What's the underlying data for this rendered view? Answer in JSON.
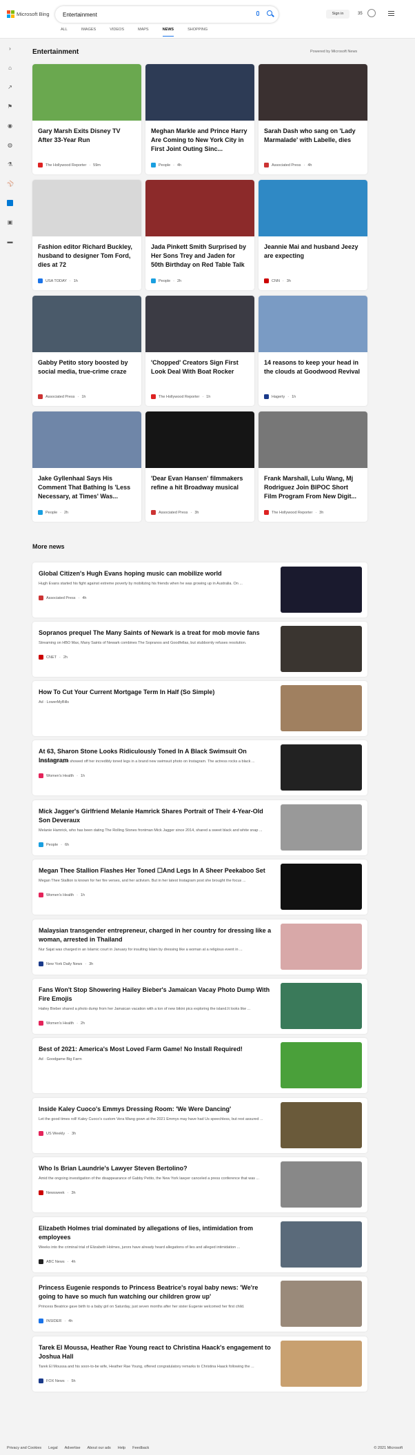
{
  "header": {
    "logo_text": "Microsoft Bing",
    "search_value": "Entertainment",
    "signin": "Sign in",
    "points": "35",
    "tabs": [
      "ALL",
      "IMAGES",
      "VIDEOS",
      "MAPS",
      "NEWS",
      "SHOPPING"
    ],
    "active_tab": "NEWS"
  },
  "section": {
    "title": "Entertainment",
    "powered": "Powered by Microsoft News"
  },
  "cards": [
    {
      "title": "Gary Marsh Exits Disney TV After 33-Year Run",
      "source": "The Hollywood Reporter",
      "time": "59m",
      "color": "#d22",
      "img": "#6aa84f"
    },
    {
      "title": "Meghan Markle and Prince Harry Are Coming to New York City in First Joint Outing Sinc...",
      "source": "People",
      "time": "4h",
      "color": "#1a9fe0",
      "img": "#2d3b55"
    },
    {
      "title": "Sarah Dash who sang on 'Lady Marmalade' with Labelle, dies",
      "source": "Associated Press",
      "time": "4h",
      "color": "#c33",
      "img": "#3a3030"
    },
    {
      "title": "Fashion editor Richard Buckley, husband to designer Tom Ford, dies at 72",
      "source": "USA TODAY",
      "time": "1h",
      "color": "#1a73e8",
      "img": "#d8d8d8"
    },
    {
      "title": "Jada Pinkett Smith Surprised by Her Sons Trey and Jaden for 50th Birthday on Red Table Talk",
      "source": "People",
      "time": "2h",
      "color": "#1a9fe0",
      "img": "#8c2a2a"
    },
    {
      "title": "Jeannie Mai and husband Jeezy are expecting",
      "source": "CNN",
      "time": "3h",
      "color": "#c00",
      "img": "#2f89c5"
    },
    {
      "title": "Gabby Petito story boosted by social media, true-crime craze",
      "source": "Associated Press",
      "time": "1h",
      "color": "#c33",
      "img": "#4a5a6a"
    },
    {
      "title": "'Chopped' Creators Sign First Look Deal With Boat Rocker",
      "source": "The Hollywood Reporter",
      "time": "1h",
      "color": "#d22",
      "img": "#3b3b44"
    },
    {
      "title": "14 reasons to keep your head in the clouds at Goodwood Revival",
      "source": "Hagerty",
      "time": "1h",
      "color": "#1a3a8a",
      "img": "#7a9bc4"
    },
    {
      "title": "Jake Gyllenhaal Says His Comment That Bathing Is 'Less Necessary, at Times' Was...",
      "source": "People",
      "time": "2h",
      "color": "#1a9fe0",
      "img": "#6f86a8"
    },
    {
      "title": "'Dear Evan Hansen' filmmakers refine a hit Broadway musical",
      "source": "Associated Press",
      "time": "3h",
      "color": "#c33",
      "img": "#151515"
    },
    {
      "title": "Frank Marshall, Lulu Wang, Mj Rodriguez Join BIPOC Short Film Program From New Digit...",
      "source": "The Hollywood Reporter",
      "time": "3h",
      "color": "#d22",
      "img": "#777"
    }
  ],
  "more_title": "More news",
  "rows": [
    {
      "title": "Global Citizen's Hugh Evans hoping music can mobilize world",
      "desc": "Hugh Evans started his fight against extreme poverty by mobilizing his friends when he was growing up in Australia. On ...",
      "source": "Associated Press",
      "time": "4h",
      "color": "#c33",
      "img": "#1a1a2e"
    },
    {
      "title": "Sopranos prequel The Many Saints of Newark is a treat for mob movie fans",
      "desc": "Streaming on HBO Max, Many Saints of Newark combines The Sopranos and Goodfellas, but stubbornly refuses resolution.",
      "source": "CNET",
      "time": "2h",
      "color": "#c00",
      "img": "#3a3530"
    },
    {
      "title": "How To Cut Your Current Mortgage Term In Half (So Simple)",
      "desc": "",
      "source": "Ad · LowerMyBills",
      "time": "",
      "color": "",
      "img": "#a08060"
    },
    {
      "title": "At 63, Sharon Stone Looks Ridiculously Toned In A Black Swimsuit On Instagram",
      "desc": "Sharon Stone just showed off her incredibly toned legs in a brand new swimsuit photo on Instagram. The actress rocks a black ...",
      "source": "Women's Health",
      "time": "1h",
      "color": "#e4245a",
      "img": "#222"
    },
    {
      "title": "Mick Jagger's Girlfriend Melanie Hamrick Shares Portrait of Their 4-Year-Old Son Deveraux",
      "desc": "Melanie Hamrick, who has been dating The Rolling Stones frontman Mick Jagger since 2014, shared a sweet black and white snap ...",
      "source": "People",
      "time": "6h",
      "color": "#1a9fe0",
      "img": "#999"
    },
    {
      "title": "Megan Thee Stallion Flashes Her Toned ☐And Legs In A Sheer Peekaboo Set",
      "desc": "Megan Thee Stallion is known for her fire verses, and her activism. But in her latest Instagram post she brought the focus ...",
      "source": "Women's Health",
      "time": "1h",
      "color": "#e4245a",
      "img": "#111"
    },
    {
      "title": "Malaysian transgender entrepreneur, charged in her country for dressing like a woman, arrested in Thailand",
      "desc": "Nur Sajat was charged in an Islamic court in January for insulting Islam by dressing like a woman at a religious event in ...",
      "source": "New York Daily News",
      "time": "3h",
      "color": "#1a3a8a",
      "img": "#d8a8a8"
    },
    {
      "title": "Fans Won't Stop Showering Hailey Bieber's Jamaican Vacay Photo Dump With Fire Emojis",
      "desc": "Hailey Bieber shared a photo dump from her Jamaican vacation with a ton of new bikini pics exploring the island.It looks like ...",
      "source": "Women's Health",
      "time": "2h",
      "color": "#e4245a",
      "img": "#3a7a5a"
    },
    {
      "title": "Best of 2021: America's Most Loved Farm Game! No Install Required!",
      "desc": "",
      "source": "Ad · Goodgame Big Farm",
      "time": "",
      "color": "",
      "img": "#4aa03a"
    },
    {
      "title": "Inside Kaley Cuoco's Emmys Dressing Room: 'We Were Dancing'",
      "desc": "Let the good times roll! Kaley Cuoco's custom Vera Wang gown at the 2021 Emmys may have had Us speechless, but rest assured ...",
      "source": "US Weekly",
      "time": "3h",
      "color": "#e4245a",
      "img": "#6a5a3a"
    },
    {
      "title": "Who Is Brian Laundrie's Lawyer Steven Bertolino?",
      "desc": "Amid the ongoing investigation of the disappearance of Gabby Petito, the New York lawyer canceled a press conference that was ...",
      "source": "Newsweek",
      "time": "3h",
      "color": "#c00",
      "img": "#888"
    },
    {
      "title": "Elizabeth Holmes trial dominated by allegations of lies, intimidation from employees",
      "desc": "Weeks into the criminal trial of Elizabeth Holmes, jurors have already heard allegations of lies and alleged intimidation ...",
      "source": "ABC News",
      "time": "4h",
      "color": "#222",
      "img": "#5a6a7a"
    },
    {
      "title": "Princess Eugenie responds to Princess Beatrice's royal baby news: 'We're going to have so much fun watching our children grow up'",
      "desc": "Princess Beatrice gave birth to a baby girl on Saturday, just seven months after her sister Eugenie welcomed her first child.",
      "source": "INSIDER",
      "time": "4h",
      "color": "#1a73e8",
      "img": "#9a8a7a"
    },
    {
      "title": "Tarek El Moussa, Heather Rae Young react to Christina Haack's engagement to Joshua Hall",
      "desc": "Tarek El Moussa and his soon-to-be wife, Heather Rae Young, offered congratulatory remarks to Christina Haack following the ...",
      "source": "FOX News",
      "time": "5h",
      "color": "#1a3a8a",
      "img": "#c8a070"
    }
  ],
  "footer": {
    "links": [
      "Privacy and Cookies",
      "Legal",
      "Advertise",
      "About our ads",
      "Help",
      "Feedback"
    ],
    "copyright": "© 2021 Microsoft"
  },
  "icons": [
    "chevron-right-icon",
    "home-icon",
    "trending-icon",
    "flag-icon",
    "location-icon",
    "globe-icon",
    "science-icon",
    "sports-icon",
    "entertainment-icon",
    "business-icon",
    "misc-icon"
  ]
}
